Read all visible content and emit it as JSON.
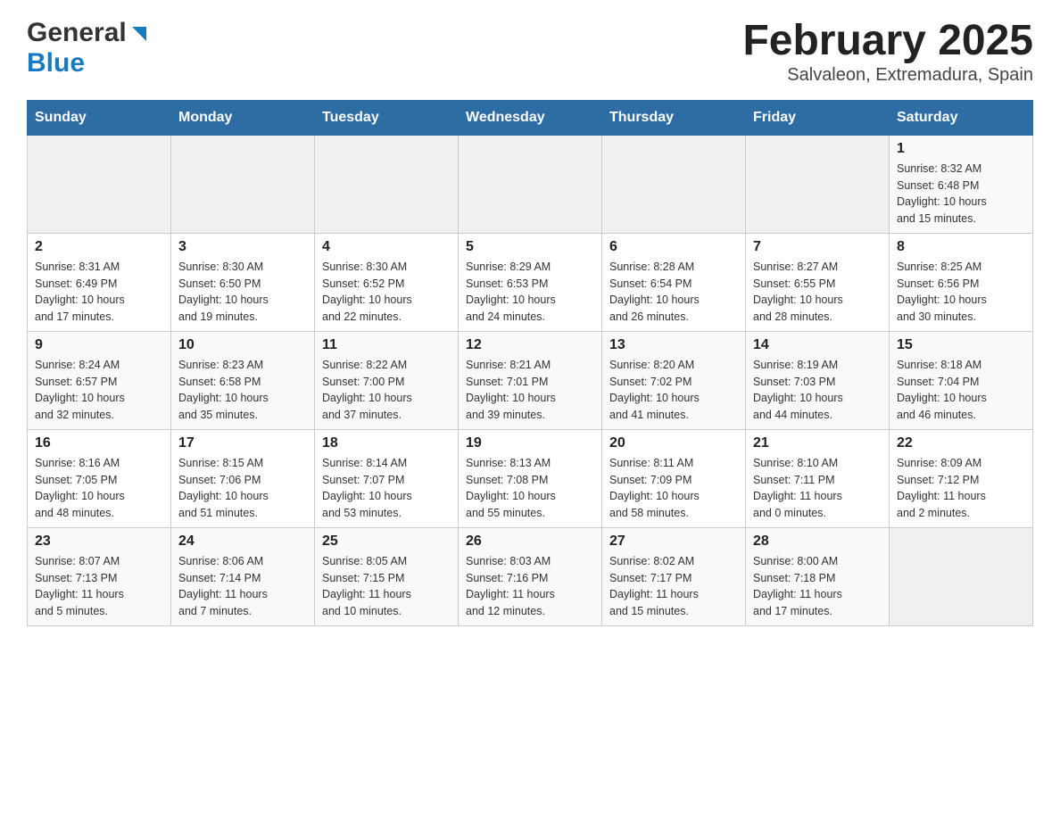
{
  "header": {
    "logo_general": "General",
    "logo_blue": "Blue",
    "title": "February 2025",
    "subtitle": "Salvaleon, Extremadura, Spain"
  },
  "days_of_week": [
    "Sunday",
    "Monday",
    "Tuesday",
    "Wednesday",
    "Thursday",
    "Friday",
    "Saturday"
  ],
  "weeks": [
    [
      {
        "day": "",
        "info": ""
      },
      {
        "day": "",
        "info": ""
      },
      {
        "day": "",
        "info": ""
      },
      {
        "day": "",
        "info": ""
      },
      {
        "day": "",
        "info": ""
      },
      {
        "day": "",
        "info": ""
      },
      {
        "day": "1",
        "info": "Sunrise: 8:32 AM\nSunset: 6:48 PM\nDaylight: 10 hours\nand 15 minutes."
      }
    ],
    [
      {
        "day": "2",
        "info": "Sunrise: 8:31 AM\nSunset: 6:49 PM\nDaylight: 10 hours\nand 17 minutes."
      },
      {
        "day": "3",
        "info": "Sunrise: 8:30 AM\nSunset: 6:50 PM\nDaylight: 10 hours\nand 19 minutes."
      },
      {
        "day": "4",
        "info": "Sunrise: 8:30 AM\nSunset: 6:52 PM\nDaylight: 10 hours\nand 22 minutes."
      },
      {
        "day": "5",
        "info": "Sunrise: 8:29 AM\nSunset: 6:53 PM\nDaylight: 10 hours\nand 24 minutes."
      },
      {
        "day": "6",
        "info": "Sunrise: 8:28 AM\nSunset: 6:54 PM\nDaylight: 10 hours\nand 26 minutes."
      },
      {
        "day": "7",
        "info": "Sunrise: 8:27 AM\nSunset: 6:55 PM\nDaylight: 10 hours\nand 28 minutes."
      },
      {
        "day": "8",
        "info": "Sunrise: 8:25 AM\nSunset: 6:56 PM\nDaylight: 10 hours\nand 30 minutes."
      }
    ],
    [
      {
        "day": "9",
        "info": "Sunrise: 8:24 AM\nSunset: 6:57 PM\nDaylight: 10 hours\nand 32 minutes."
      },
      {
        "day": "10",
        "info": "Sunrise: 8:23 AM\nSunset: 6:58 PM\nDaylight: 10 hours\nand 35 minutes."
      },
      {
        "day": "11",
        "info": "Sunrise: 8:22 AM\nSunset: 7:00 PM\nDaylight: 10 hours\nand 37 minutes."
      },
      {
        "day": "12",
        "info": "Sunrise: 8:21 AM\nSunset: 7:01 PM\nDaylight: 10 hours\nand 39 minutes."
      },
      {
        "day": "13",
        "info": "Sunrise: 8:20 AM\nSunset: 7:02 PM\nDaylight: 10 hours\nand 41 minutes."
      },
      {
        "day": "14",
        "info": "Sunrise: 8:19 AM\nSunset: 7:03 PM\nDaylight: 10 hours\nand 44 minutes."
      },
      {
        "day": "15",
        "info": "Sunrise: 8:18 AM\nSunset: 7:04 PM\nDaylight: 10 hours\nand 46 minutes."
      }
    ],
    [
      {
        "day": "16",
        "info": "Sunrise: 8:16 AM\nSunset: 7:05 PM\nDaylight: 10 hours\nand 48 minutes."
      },
      {
        "day": "17",
        "info": "Sunrise: 8:15 AM\nSunset: 7:06 PM\nDaylight: 10 hours\nand 51 minutes."
      },
      {
        "day": "18",
        "info": "Sunrise: 8:14 AM\nSunset: 7:07 PM\nDaylight: 10 hours\nand 53 minutes."
      },
      {
        "day": "19",
        "info": "Sunrise: 8:13 AM\nSunset: 7:08 PM\nDaylight: 10 hours\nand 55 minutes."
      },
      {
        "day": "20",
        "info": "Sunrise: 8:11 AM\nSunset: 7:09 PM\nDaylight: 10 hours\nand 58 minutes."
      },
      {
        "day": "21",
        "info": "Sunrise: 8:10 AM\nSunset: 7:11 PM\nDaylight: 11 hours\nand 0 minutes."
      },
      {
        "day": "22",
        "info": "Sunrise: 8:09 AM\nSunset: 7:12 PM\nDaylight: 11 hours\nand 2 minutes."
      }
    ],
    [
      {
        "day": "23",
        "info": "Sunrise: 8:07 AM\nSunset: 7:13 PM\nDaylight: 11 hours\nand 5 minutes."
      },
      {
        "day": "24",
        "info": "Sunrise: 8:06 AM\nSunset: 7:14 PM\nDaylight: 11 hours\nand 7 minutes."
      },
      {
        "day": "25",
        "info": "Sunrise: 8:05 AM\nSunset: 7:15 PM\nDaylight: 11 hours\nand 10 minutes."
      },
      {
        "day": "26",
        "info": "Sunrise: 8:03 AM\nSunset: 7:16 PM\nDaylight: 11 hours\nand 12 minutes."
      },
      {
        "day": "27",
        "info": "Sunrise: 8:02 AM\nSunset: 7:17 PM\nDaylight: 11 hours\nand 15 minutes."
      },
      {
        "day": "28",
        "info": "Sunrise: 8:00 AM\nSunset: 7:18 PM\nDaylight: 11 hours\nand 17 minutes."
      },
      {
        "day": "",
        "info": ""
      }
    ]
  ]
}
